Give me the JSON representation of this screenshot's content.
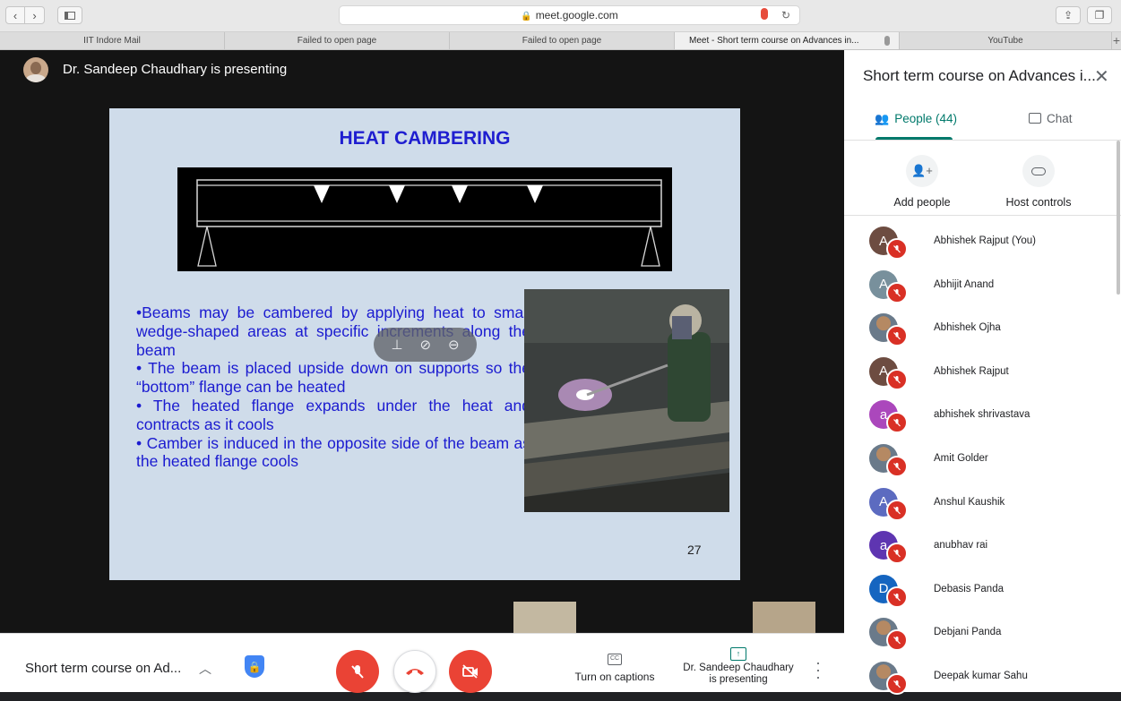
{
  "browser": {
    "url": "meet.google.com",
    "tabs": [
      {
        "label": "IIT Indore Mail",
        "active": false
      },
      {
        "label": "Failed to open page",
        "active": false
      },
      {
        "label": "Failed to open page",
        "active": false
      },
      {
        "label": "Meet - Short term course on Advances in...",
        "active": true
      },
      {
        "label": "YouTube",
        "active": false
      }
    ],
    "new_tab": "+"
  },
  "stage": {
    "presenting_text": "Dr. Sandeep Chaudhary is presenting",
    "slide": {
      "title": "HEAT CAMBERING",
      "bullets": [
        "•Beams may be cambered by applying heat to small wedge-shaped areas at specific increments along the beam",
        "• The beam is placed upside down on supports so the “bottom” flange can be heated",
        "• The heated flange expands under the heat and contracts as it cools",
        "• Camber is induced in the opposite side of the beam as the heated flange cools"
      ],
      "page_number": "27"
    }
  },
  "bottom_bar": {
    "meeting_name": "Short term course on Ad...",
    "captions_label": "Turn on captions",
    "presenting_line1": "Dr. Sandeep Chaudhary",
    "presenting_line2": "is presenting"
  },
  "panel": {
    "title": "Short term course on Advances i...",
    "tab_people": "People (44)",
    "tab_chat": "Chat",
    "add_people": "Add people",
    "host_controls": "Host controls",
    "participants": [
      {
        "initial": "A",
        "name": "Abhishek Rajput (You)",
        "color": "#6d4c41",
        "photo": false
      },
      {
        "initial": "A",
        "name": "Abhijit Anand",
        "color": "#78909c",
        "photo": false
      },
      {
        "initial": "",
        "name": "Abhishek Ojha",
        "color": "#5c6b7a",
        "photo": true
      },
      {
        "initial": "A",
        "name": "Abhishek Rajput",
        "color": "#6d4c41",
        "photo": false
      },
      {
        "initial": "a",
        "name": "abhishek shrivastava",
        "color": "#ab47bc",
        "photo": false
      },
      {
        "initial": "",
        "name": "Amit Golder",
        "color": "#7a6a52",
        "photo": true
      },
      {
        "initial": "A",
        "name": "Anshul Kaushik",
        "color": "#5c6bc0",
        "photo": false
      },
      {
        "initial": "a",
        "name": "anubhav rai",
        "color": "#5e35b1",
        "photo": false
      },
      {
        "initial": "D",
        "name": "Debasis Panda",
        "color": "#1565c0",
        "photo": false
      },
      {
        "initial": "",
        "name": "Debjani Panda",
        "color": "#8a6a6a",
        "photo": true
      },
      {
        "initial": "",
        "name": "Deepak kumar Sahu",
        "color": "#6a7a6a",
        "photo": true
      }
    ]
  },
  "colors": {
    "accent": "#00796b",
    "danger": "#ea4335",
    "slide_text": "#1b1bd0"
  }
}
